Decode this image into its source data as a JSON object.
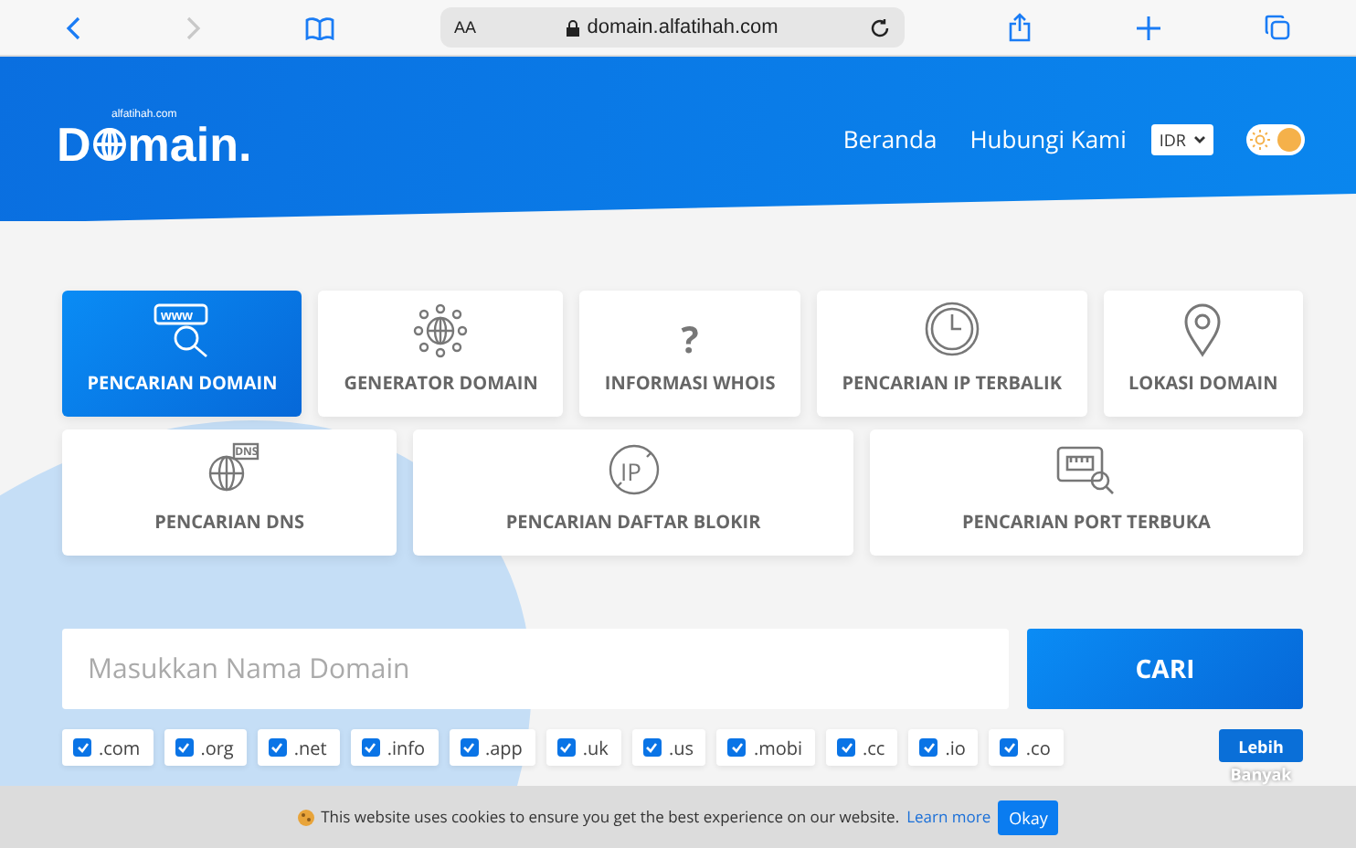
{
  "browser": {
    "text_size": "AA",
    "url": "domain.alfatihah.com"
  },
  "header": {
    "logo_small": "alfatihah.com",
    "logo": "D",
    "logo_rest": "main.",
    "nav": [
      "Beranda",
      "Hubungi Kami"
    ],
    "currency": "IDR",
    "dark_mode": false
  },
  "tools": [
    {
      "label": "PENCARIAN DOMAIN",
      "selected": true,
      "icon_text": "www"
    },
    {
      "label": "GENERATOR DOMAIN",
      "selected": false
    },
    {
      "label": "INFORMASI WHOIS",
      "selected": false,
      "glyph": "?"
    },
    {
      "label": "PENCARIAN IP TERBALIK",
      "selected": false
    },
    {
      "label": "LOKASI DOMAIN",
      "selected": false
    },
    {
      "label": "PENCARIAN DNS",
      "selected": false,
      "badge": "DNS"
    },
    {
      "label": "PENCARIAN DAFTAR BLOKIR",
      "selected": false,
      "badge": "IP"
    },
    {
      "label": "PENCARIAN PORT TERBUKA",
      "selected": false
    }
  ],
  "search": {
    "placeholder": "Masukkan Nama Domain",
    "button": "CARI"
  },
  "extensions": [
    {
      "label": ".com",
      "checked": true
    },
    {
      "label": ".org",
      "checked": true
    },
    {
      "label": ".net",
      "checked": true
    },
    {
      "label": ".info",
      "checked": true
    },
    {
      "label": ".app",
      "checked": true
    },
    {
      "label": ".uk",
      "checked": true
    },
    {
      "label": ".us",
      "checked": true
    },
    {
      "label": ".mobi",
      "checked": true
    },
    {
      "label": ".cc",
      "checked": true
    },
    {
      "label": ".io",
      "checked": true
    },
    {
      "label": ".co",
      "checked": true
    }
  ],
  "more_button": {
    "label": "Lebih",
    "overflow": "Banyak"
  },
  "cookie_bar": {
    "text": "This website uses cookies to ensure you get the best experience on our website.",
    "link": "Learn more",
    "button": "Okay"
  }
}
